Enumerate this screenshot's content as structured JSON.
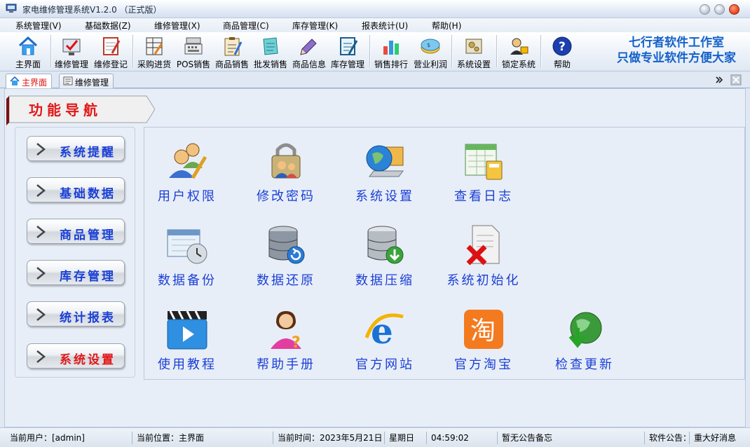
{
  "window": {
    "title": "家电维修管理系统V1.2.0 （正式版）"
  },
  "menu": [
    {
      "label": "系统管理(V)"
    },
    {
      "label": "基础数据(Z)"
    },
    {
      "label": "维修管理(X)"
    },
    {
      "label": "商品管理(C)"
    },
    {
      "label": "库存管理(K)"
    },
    {
      "label": "报表统计(U)"
    },
    {
      "label": "帮助(H)"
    }
  ],
  "toolbar": {
    "items": [
      {
        "label": "主界面",
        "icon": "home-icon"
      },
      {
        "label": "维修管理",
        "icon": "repair-check-icon"
      },
      {
        "label": "维修登记",
        "icon": "register-notebook-icon"
      },
      {
        "label": "采购进货",
        "icon": "purchase-sheet-icon"
      },
      {
        "label": "POS销售",
        "icon": "cash-register-icon"
      },
      {
        "label": "商品销售",
        "icon": "sales-clipboard-icon"
      },
      {
        "label": "批发销售",
        "icon": "wholesale-notebook-icon"
      },
      {
        "label": "商品信息",
        "icon": "product-pen-icon"
      },
      {
        "label": "库存管理",
        "icon": "inventory-notebook-icon"
      },
      {
        "label": "销售排行",
        "icon": "bar-chart-icon"
      },
      {
        "label": "营业利润",
        "icon": "profit-coins-icon"
      },
      {
        "label": "系统设置",
        "icon": "settings-gear-icon"
      },
      {
        "label": "锁定系统",
        "icon": "lock-user-icon"
      },
      {
        "label": "帮助",
        "icon": "help-icon"
      }
    ],
    "brand_line1": "七行者软件工作室",
    "brand_line2": "只做专业软件方便大家"
  },
  "tabs": [
    {
      "label": "主界面",
      "active": true
    },
    {
      "label": "维修管理",
      "active": false
    }
  ],
  "nav": {
    "title": "功能导航",
    "buttons": [
      {
        "label": "系统提醒"
      },
      {
        "label": "基础数据"
      },
      {
        "label": "商品管理"
      },
      {
        "label": "库存管理"
      },
      {
        "label": "统计报表"
      },
      {
        "label": "系统设置"
      }
    ]
  },
  "functions": [
    {
      "label": "用户权限",
      "icon": "users-icon"
    },
    {
      "label": "修改密码",
      "icon": "password-lock-icon"
    },
    {
      "label": "系统设置",
      "icon": "globe-laptop-icon"
    },
    {
      "label": "查看日志",
      "icon": "log-calculator-icon"
    },
    {
      "label": "数据备份",
      "icon": "backup-calendar-icon"
    },
    {
      "label": "数据还原",
      "icon": "database-restore-icon"
    },
    {
      "label": "数据压缩",
      "icon": "database-compress-icon"
    },
    {
      "label": "系统初始化",
      "icon": "document-delete-icon"
    },
    {
      "label": "使用教程",
      "icon": "video-tutorial-icon"
    },
    {
      "label": "帮助手册",
      "icon": "help-person-icon"
    },
    {
      "label": "官方网站",
      "icon": "ie-browser-icon"
    },
    {
      "label": "官方淘宝",
      "icon": "taobao-icon"
    },
    {
      "label": "检查更新",
      "icon": "update-globe-icon"
    }
  ],
  "status": {
    "user": "当前用户：[admin]",
    "location": "当前位置：主界面",
    "time_label": "当前时间：2023年5月21日",
    "weekday": "星期日",
    "clock": "04:59:02",
    "memo": "暂无公告备忘",
    "notice_label": "软件公告：",
    "notice_text": "重大好消息"
  },
  "colors": {
    "accent_blue": "#1a3fd6",
    "accent_red": "#e21818",
    "brand_blue": "#1461c9"
  }
}
